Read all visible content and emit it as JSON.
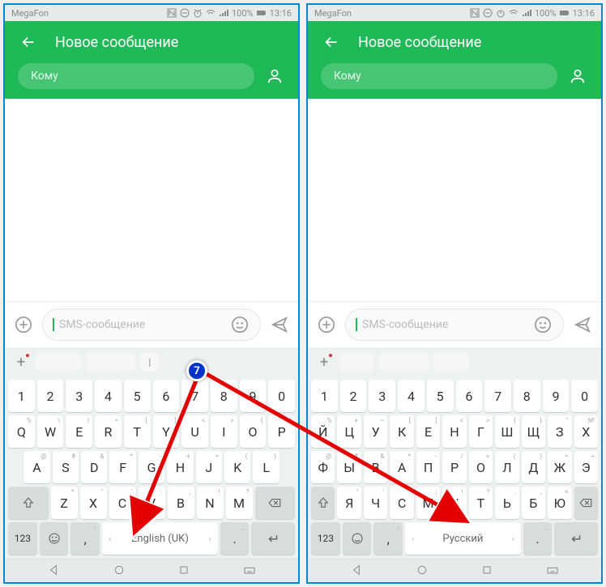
{
  "annotation": {
    "badge": "7"
  },
  "status": {
    "carrier": "MegaFon",
    "battery": "100%",
    "time": "13:16"
  },
  "header": {
    "title": "Новое сообщение"
  },
  "recipient": {
    "placeholder": "Кому"
  },
  "compose": {
    "placeholder": "SMS-сообщение"
  },
  "suggestions_en": [
    "blurred",
    "blurred",
    "|"
  ],
  "suggestions_ru": [
    "blurred",
    "blurred",
    "blurred"
  ],
  "nums": [
    "1",
    "2",
    "3",
    "4",
    "5",
    "6",
    "7",
    "8",
    "9",
    "0"
  ],
  "en": {
    "r1": [
      [
        "Q",
        "%"
      ],
      [
        "W",
        "\\"
      ],
      [
        "E",
        "|"
      ],
      [
        "R",
        "="
      ],
      [
        "T",
        "["
      ],
      [
        "Y",
        "]"
      ],
      [
        "U",
        "<"
      ],
      [
        "I",
        ">"
      ],
      [
        "O",
        "{"
      ],
      [
        "P",
        "}"
      ]
    ],
    "r2": [
      [
        "A",
        "@"
      ],
      [
        "S",
        "#"
      ],
      [
        "D",
        "&"
      ],
      [
        "F",
        "*"
      ],
      [
        "G",
        "-"
      ],
      [
        "H",
        "+"
      ],
      [
        "J",
        "="
      ],
      [
        "K",
        "("
      ],
      [
        "L",
        ")"
      ]
    ],
    "r3": [
      [
        "Z",
        "*"
      ],
      [
        "X",
        "\""
      ],
      [
        "C",
        "'"
      ],
      [
        "V",
        ":"
      ],
      [
        "B",
        ";"
      ],
      [
        "N",
        "!"
      ],
      [
        "M",
        "?"
      ]
    ],
    "space": "English (UK)",
    "sym": "123"
  },
  "ru": {
    "r1": [
      [
        "Й",
        "%"
      ],
      [
        "Ц",
        "+"
      ],
      [
        "У",
        "~"
      ],
      [
        "К",
        "["
      ],
      [
        "Е",
        "]"
      ],
      [
        "Н",
        "<"
      ],
      [
        "Г",
        ">"
      ],
      [
        "Ш",
        "{"
      ],
      [
        "Щ",
        "}"
      ],
      [
        "З",
        "\""
      ],
      [
        "Х",
        "№"
      ]
    ],
    "r2": [
      [
        "Ф",
        "@"
      ],
      [
        "Ы",
        "#"
      ],
      [
        "В",
        "&"
      ],
      [
        "А",
        "*"
      ],
      [
        "П",
        "-"
      ],
      [
        "Р",
        "/"
      ],
      [
        "О",
        "+"
      ],
      [
        "Л",
        "("
      ],
      [
        "Д",
        ")"
      ],
      [
        "Ж",
        "="
      ],
      [
        "Э",
        "÷"
      ]
    ],
    "r3": [
      [
        "Я",
        "\""
      ],
      [
        "Ч",
        "'"
      ],
      [
        "С",
        ":"
      ],
      [
        "М",
        ";"
      ],
      [
        "И",
        "!"
      ],
      [
        "Т",
        "?"
      ],
      [
        "Ь",
        "."
      ],
      [
        "Б",
        ","
      ],
      [
        "Ю",
        "×"
      ]
    ],
    "space": "Русский",
    "sym": "123"
  },
  "punct": {
    "comma": ",",
    "dot": "."
  }
}
